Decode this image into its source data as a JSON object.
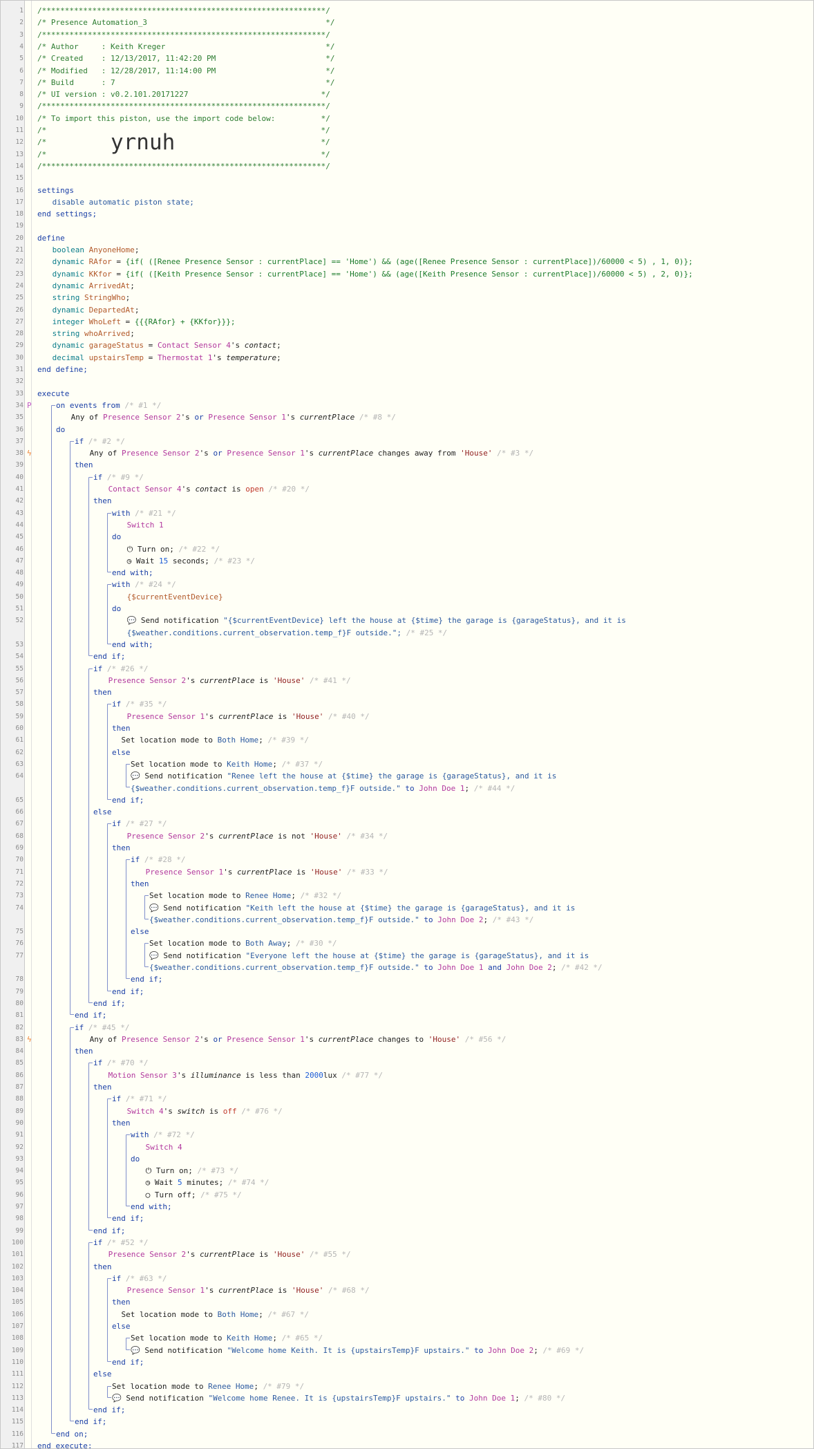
{
  "header": {
    "hline": "/**************************************************************/",
    "title": "/* Presence Automation_3                                       */",
    "author": "/* Author     : Keith Kreger                                   */",
    "created": "/* Created    : 12/13/2017, 11:42:20 PM                        */",
    "modified": "/* Modified   : 12/28/2017, 11:14:00 PM                        */",
    "build": "/* Build      : 7                                              */",
    "ui_version": "/* UI version : v0.2.101.20171227                             */",
    "import_note": "/* To import this piston, use the import code below:          */",
    "blank_open": "/*",
    "blank_close": "*/",
    "import_code": "yrnuh"
  },
  "kw": {
    "settings": "settings",
    "disable": "disable automatic piston state;",
    "end_settings": "end settings;",
    "define": "define",
    "end_define": "end define;",
    "execute": "execute",
    "end_execute": "end execute;",
    "on_events": "on events from",
    "do": "do",
    "if": "if",
    "then": "then",
    "else": "else",
    "end_if": "end if;",
    "with": "with",
    "end_with": "end with;",
    "end_on": "end on;",
    "any_of": "Any of",
    "or": "or",
    "to": "to",
    "and": "and"
  },
  "vars": {
    "boolean": "boolean",
    "dynamic": "dynamic",
    "string": "string",
    "integer": "integer",
    "decimal": "decimal",
    "AnyoneHome": "AnyoneHome",
    "RAfor": "RAfor",
    "KKfor": "KKfor",
    "ArrivedAt": "ArrivedAt",
    "StringWho": "StringWho",
    "DepartedAt": "DepartedAt",
    "WhoLeft": "WhoLeft",
    "whoArrived": "whoArrived",
    "garageStatus": "garageStatus",
    "upstairsTemp": "upstairsTemp",
    "rafor_expr": "{if( ([Renee Presence Sensor : currentPlace] == 'Home') && (age([Renee Presence Sensor : currentPlace])/60000 < 5) , 1, 0)};",
    "kkfor_expr": "{if( ([Keith Presence Sensor : currentPlace] == 'Home') && (age([Keith Presence Sensor : currentPlace])/60000 < 5) , 2, 0)};",
    "wholeft_expr": "{{{RAfor} + {KKfor}}};"
  },
  "dev": {
    "ps2": "Presence Sensor 2",
    "ps1": "Presence Sensor 1",
    "cs4": "Contact Sensor 4",
    "th1": "Thermostat 1",
    "sw1": "Switch 1",
    "sw4": "Switch 4",
    "ms3": "Motion Sensor 3",
    "ced": "{$currentEventDevice}",
    "jd1": "John Doe 1",
    "jd2": "John Doe 2"
  },
  "attr": {
    "contact": "contact",
    "temperature": "temperature",
    "currentPlace": "currentPlace",
    "illuminance": "illuminance",
    "switch": "switch"
  },
  "txt": {
    "s_contact_eq": "'s contact;",
    "s_temp_eq": "'s temperature;",
    "s": "'s",
    "semi": ";",
    "eq": "=",
    "changes_away": "changes away from",
    "changes_to": "changes to",
    "is": "is",
    "is_not": "is not",
    "is_less_than": "is less than",
    "open": "open",
    "off": "off",
    "house": "'House'",
    "lux_value": "2000",
    "lux_unit": "lux",
    "turn_on": "Turn on;",
    "turn_off": "Turn off;",
    "wait": "Wait",
    "wait15": "15",
    "seconds": "seconds;",
    "wait5": "5",
    "minutes": "minutes;",
    "set_mode": "Set location mode to",
    "both_home": "Both Home",
    "keith_home": "Keith Home",
    "renee_home": "Renee Home",
    "both_away": "Both Away",
    "send_notif": "Send notification",
    "msg1a": "\"{$currentEventDevice} left the house at {$time} the garage is {garageStatus}, and it is",
    "msg1b": "{$weather.conditions.current_observation.temp_f}F outside.\";",
    "msg2a": "\"Renee left the house at {$time} the garage is {garageStatus}, and it is",
    "msg3a": "\"Keith left the house at {$time} the garage is {garageStatus}, and it is",
    "msg4a": "\"Everyone left the house at {$time} the garage is {garageStatus}, and it is",
    "msg_tail": "{$weather.conditions.current_observation.temp_f}F outside.\"",
    "msg_keith": "\"Welcome home Keith. It is {upstairsTemp}F upstairs.\"",
    "msg_renee": "\"Welcome home Renee. It is {upstairsTemp}F upstairs.\""
  },
  "cm": {
    "c1": "/* #1 */",
    "c8": "/* #8 */",
    "c2": "/* #2 */",
    "c3": "/* #3 */",
    "c9": "/* #9 */",
    "c20": "/* #20 */",
    "c21": "/* #21 */",
    "c22": "/* #22 */",
    "c23": "/* #23 */",
    "c24": "/* #24 */",
    "c25": "/* #25 */",
    "c26": "/* #26 */",
    "c41": "/* #41 */",
    "c35": "/* #35 */",
    "c40": "/* #40 */",
    "c39": "/* #39 */",
    "c37": "/* #37 */",
    "c44": "/* #44 */",
    "c27": "/* #27 */",
    "c34": "/* #34 */",
    "c28": "/* #28 */",
    "c33": "/* #33 */",
    "c32": "/* #32 */",
    "c43": "/* #43 */",
    "c30": "/* #30 */",
    "c42": "/* #42 */",
    "c45": "/* #45 */",
    "c56": "/* #56 */",
    "c70": "/* #70 */",
    "c77": "/* #77 */",
    "c71": "/* #71 */",
    "c76": "/* #76 */",
    "c72": "/* #72 */",
    "c73": "/* #73 */",
    "c74": "/* #74 */",
    "c75": "/* #75 */",
    "c52": "/* #52 */",
    "c55": "/* #55 */",
    "c63": "/* #63 */",
    "c68": "/* #68 */",
    "c67": "/* #67 */",
    "c65": "/* #65 */",
    "c69": "/* #69 */",
    "c79": "/* #79 */",
    "c80": "/* #80 */"
  },
  "icons": {
    "power": "⏻",
    "clock": "◷",
    "power_off": "◯",
    "chat": "💬",
    "trigger": "ϟ"
  },
  "line_count": 117
}
